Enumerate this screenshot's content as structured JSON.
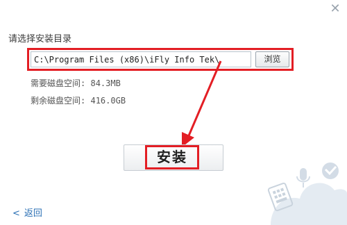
{
  "window": {
    "close_glyph": "✕"
  },
  "install_dir": {
    "title": "请选择安装目录",
    "path_value": "C:\\Program Files (x86)\\iFly Info Tek\\",
    "browse_label": "浏览"
  },
  "disk": {
    "required_label": "需要磁盘空间:",
    "required_value": "84.3MB",
    "free_label": "剩余磁盘空间:",
    "free_value": "416.0GB"
  },
  "actions": {
    "install_label": "安装",
    "back_label": "返回",
    "back_glyph": "<"
  },
  "colors": {
    "highlight": "#e31e24",
    "link": "#2a6fb4",
    "cloud": "#dde6ef"
  },
  "icons": [
    "close-icon",
    "back-arrow-icon",
    "keyboard-icon",
    "microphone-icon",
    "handwriting-icon",
    "cloud-icon"
  ]
}
